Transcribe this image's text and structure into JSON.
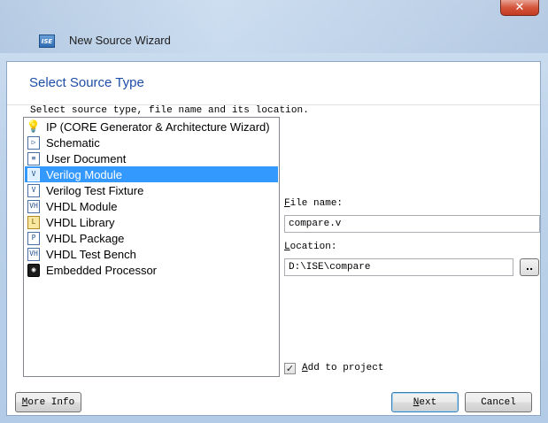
{
  "window": {
    "title": "New Source Wizard",
    "app_icon_text": "ISE",
    "close_glyph": "✕"
  },
  "page": {
    "title": "Select Source Type",
    "instruction": "Select source type, file name and its location."
  },
  "source_types": [
    {
      "label": "IP (CORE Generator & Architecture Wizard)",
      "icon": "bulb-icon",
      "glyph": "💡",
      "selected": false
    },
    {
      "label": "Schematic",
      "icon": "schematic-icon",
      "glyph": "▷",
      "selected": false
    },
    {
      "label": "User Document",
      "icon": "document-icon",
      "glyph": "≡",
      "selected": false
    },
    {
      "label": "Verilog Module",
      "icon": "verilog-module-icon",
      "glyph": "V",
      "selected": true
    },
    {
      "label": "Verilog Test Fixture",
      "icon": "verilog-test-fixture-icon",
      "glyph": "V",
      "selected": false
    },
    {
      "label": "VHDL Module",
      "icon": "vhdl-module-icon",
      "glyph": "VH",
      "selected": false
    },
    {
      "label": "VHDL Library",
      "icon": "vhdl-library-icon",
      "glyph": "L",
      "selected": false
    },
    {
      "label": "VHDL Package",
      "icon": "vhdl-package-icon",
      "glyph": "P",
      "selected": false
    },
    {
      "label": "VHDL Test Bench",
      "icon": "vhdl-test-bench-icon",
      "glyph": "VH",
      "selected": false
    },
    {
      "label": "Embedded Processor",
      "icon": "embedded-processor-icon",
      "glyph": "◉",
      "selected": false
    }
  ],
  "form": {
    "file_name_label_key": "F",
    "file_name_label_rest": "ile name:",
    "file_name_value": "compare.v",
    "location_label_key": "L",
    "location_label_rest": "ocation:",
    "location_value": "D:\\ISE\\compare",
    "browse_label": "..",
    "add_to_project_key": "A",
    "add_to_project_rest": "dd to project",
    "add_to_project_checked": true,
    "check_glyph": "✓"
  },
  "buttons": {
    "more_info_key": "M",
    "more_info_rest": "ore Info",
    "next_key": "N",
    "next_rest": "ext",
    "cancel": "Cancel"
  },
  "colors": {
    "title_blue": "#1f4ea8",
    "selection": "#3399ff"
  }
}
